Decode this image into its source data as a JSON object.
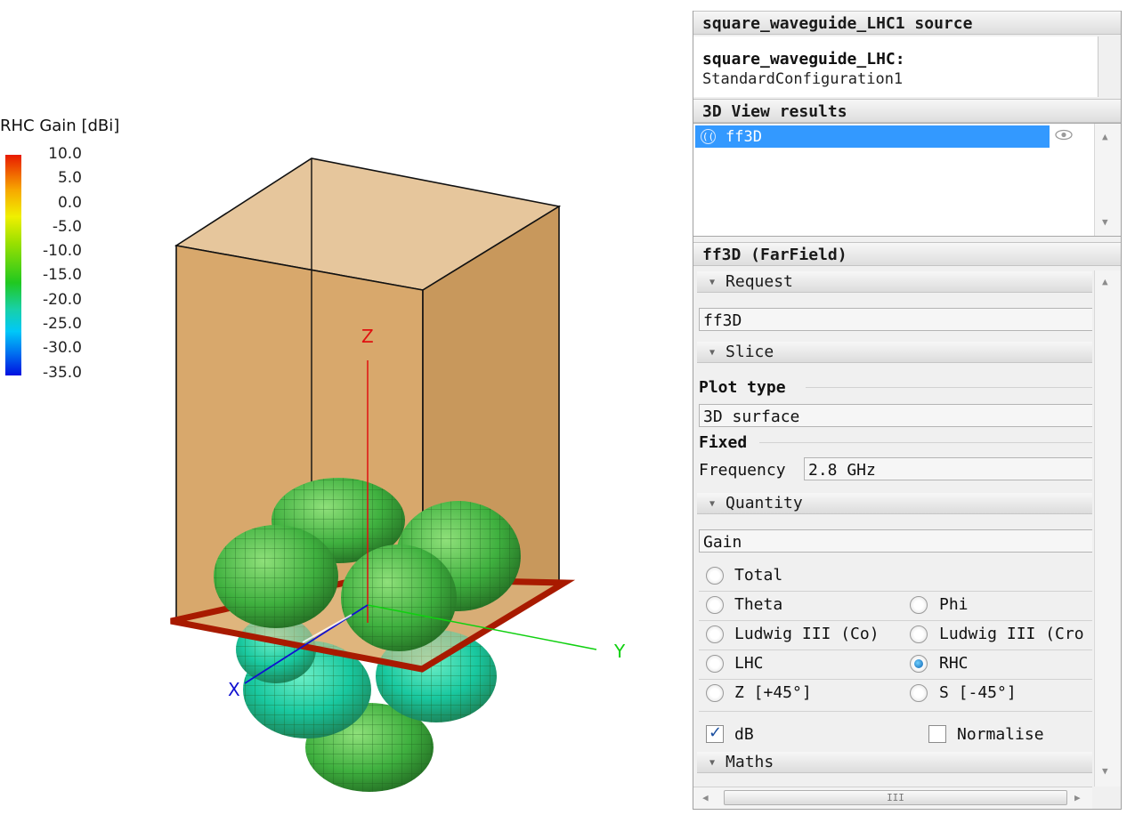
{
  "legend": {
    "title": "RHC Gain [dBi]",
    "ticks": [
      "10.0",
      "5.0",
      "0.0",
      "-5.0",
      "-10.0",
      "-15.0",
      "-20.0",
      "-25.0",
      "-30.0",
      "-35.0"
    ]
  },
  "axes": {
    "x": "X",
    "y": "Y",
    "z": "Z"
  },
  "colors": {
    "box_face": "#d8a86c",
    "box_edge": "#111111",
    "ground_plane": "#a81a00",
    "lobe_green": "#3fb03f",
    "lobe_cyan": "#19c8a0",
    "axis_x": "#1010d0",
    "axis_y": "#10d010",
    "axis_z": "#e01010",
    "selection": "#3399ff"
  },
  "panel": {
    "source_header": "square_waveguide_LHC1 source",
    "source_title": "square_waveguide_LHC:",
    "source_sub": "StandardConfiguration1",
    "results_header": "3D View results",
    "result_item": {
      "label": "ff3D",
      "icon": "radio-wave-icon",
      "visibility_icon": "eye-icon"
    },
    "properties_header": "ff3D (FarField)",
    "request": {
      "header": "Request",
      "value": "ff3D"
    },
    "slice": {
      "header": "Slice",
      "plot_type_label": "Plot type",
      "plot_type_value": "3D surface",
      "fixed_label": "Fixed",
      "frequency_label": "Frequency",
      "frequency_value": "2.8 GHz"
    },
    "quantity": {
      "header": "Quantity",
      "value": "Gain",
      "options": [
        {
          "label": "Total",
          "checked": false
        },
        {
          "label": "Theta",
          "checked": false
        },
        {
          "label": "Phi",
          "checked": false
        },
        {
          "label": "Ludwig III (Co)",
          "checked": false
        },
        {
          "label": "Ludwig III (Cro",
          "checked": false
        },
        {
          "label": "LHC",
          "checked": false
        },
        {
          "label": "RHC",
          "checked": true
        },
        {
          "label": "Z [+45°]",
          "checked": false
        },
        {
          "label": "S [-45°]",
          "checked": false
        }
      ],
      "db_label": "dB",
      "db_checked": true,
      "normalise_label": "Normalise",
      "normalise_checked": false
    },
    "maths": {
      "header": "Maths"
    }
  }
}
